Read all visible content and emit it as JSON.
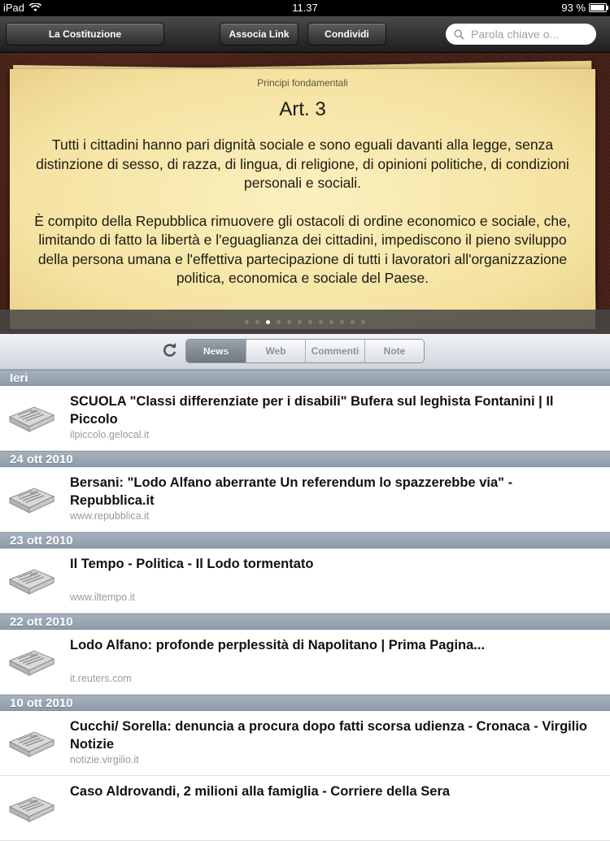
{
  "status": {
    "device": "iPad",
    "time": "11.37",
    "battery": "93 %",
    "battery_level": 0.93
  },
  "toolbar": {
    "constitution_button": "La Costituzione",
    "associate_link_button": "Associa Link",
    "share_button": "Condividi",
    "search_placeholder": "Parola chiave o..."
  },
  "article": {
    "section": "Principi fondamentali",
    "title": "Art. 3",
    "paragraph1": "Tutti i cittadini hanno pari dignità sociale e sono eguali davanti alla legge, senza distinzione di sesso, di razza, di lingua, di religione, di opinioni politiche, di condizioni personali e sociali.",
    "paragraph2": "È compito della Repubblica rimuovere gli ostacoli di ordine economico e sociale, che, limitando di fatto la libertà e l'eguaglianza dei cittadini, impediscono il pieno sviluppo della persona umana e l'effettiva partecipazione di tutti i lavoratori all'organizzazione politica, economica e sociale del Paese."
  },
  "pager": {
    "count": 12,
    "active_index": 2
  },
  "tabs": {
    "news": "News",
    "web": "Web",
    "comments": "Commenti",
    "notes": "Note",
    "active": "news"
  },
  "news": {
    "groups": [
      {
        "date": "Ieri",
        "items": [
          {
            "title": "SCUOLA \"Classi differenziate per i disabili\" Bufera sul leghista Fontanini  | Il Piccolo",
            "source": "ilpiccolo.gelocal.it"
          }
        ]
      },
      {
        "date": "24 ott 2010",
        "items": [
          {
            "title": "Bersani: \"Lodo Alfano aberrante Un referendum lo spazzerebbe via\" - Repubblica.it",
            "source": "www.repubblica.it"
          }
        ]
      },
      {
        "date": "23 ott 2010",
        "items": [
          {
            "title": "Il Tempo - Politica - Il Lodo tormentato",
            "source": "www.iltempo.it"
          }
        ]
      },
      {
        "date": "22 ott 2010",
        "items": [
          {
            "title": "Lodo Alfano: profonde perplessità di Napolitano | Prima Pagina...",
            "source": "it.reuters.com"
          }
        ]
      },
      {
        "date": "10 ott 2010",
        "items": [
          {
            "title": "Cucchi/ Sorella: denuncia a procura dopo fatti scorsa udienza - Cronaca - Virgilio Notizie",
            "source": "notizie.virgilio.it"
          },
          {
            "title": "Caso Aldrovandi,  2 milioni alla famiglia - Corriere della Sera",
            "source": ""
          }
        ]
      }
    ]
  }
}
